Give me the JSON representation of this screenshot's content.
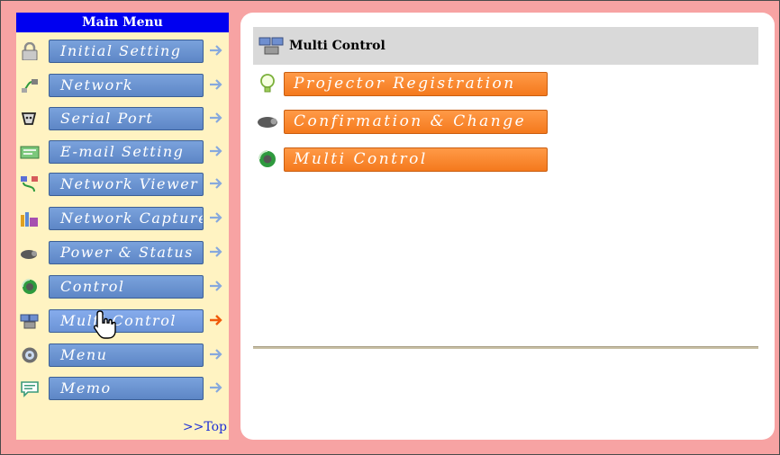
{
  "sidebar": {
    "title": "Main Menu",
    "items": [
      {
        "label": "Initial Setting",
        "icon": "padlock-icon"
      },
      {
        "label": "Network",
        "icon": "network-plug-icon"
      },
      {
        "label": "Serial Port",
        "icon": "serial-connector-icon"
      },
      {
        "label": "E-mail Setting",
        "icon": "email-card-icon"
      },
      {
        "label": "Network Viewer",
        "icon": "network-viewer-icon"
      },
      {
        "label": "Network Capture",
        "icon": "network-capture-icon"
      },
      {
        "label": "Power & Status",
        "icon": "projector-icon"
      },
      {
        "label": "Control",
        "icon": "control-globe-icon"
      },
      {
        "label": "Multi Control",
        "icon": "multi-projector-icon",
        "active": true
      },
      {
        "label": "Menu",
        "icon": "menu-disc-icon"
      },
      {
        "label": "Memo",
        "icon": "memo-bubble-icon"
      }
    ],
    "top_link": ">>Top"
  },
  "content": {
    "header_title": "Multi Control",
    "header_icon": "multi-projector-icon",
    "submenu": [
      {
        "label": "Projector Registration",
        "icon": "lightbulb-icon"
      },
      {
        "label": "Confirmation & Change",
        "icon": "projector-icon"
      },
      {
        "label": "Multi Control",
        "icon": "control-globe-icon"
      }
    ]
  },
  "colors": {
    "frame_bg": "#f7a3a3",
    "sidebar_bg": "#fff3c2",
    "menu_title_bg": "#0000f0",
    "menu_button": "#6a93d3",
    "submenu_button": "#f7832a",
    "arrow_normal": "#87a9dd",
    "arrow_active": "#f05a0a"
  }
}
